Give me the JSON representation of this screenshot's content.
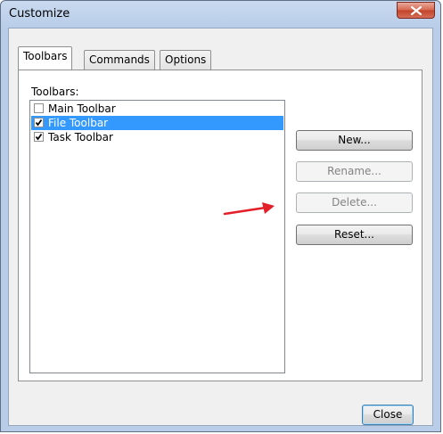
{
  "window": {
    "title": "Customize"
  },
  "tabs": [
    {
      "label": "Toolbars",
      "active": true
    },
    {
      "label": "Commands",
      "active": false
    },
    {
      "label": "Options",
      "active": false
    }
  ],
  "toolbars_group": {
    "label": "Toolbars:",
    "items": [
      {
        "label": "Main Toolbar",
        "checked": false,
        "selected": false
      },
      {
        "label": "File Toolbar",
        "checked": true,
        "selected": true
      },
      {
        "label": "Task Toolbar",
        "checked": true,
        "selected": false
      }
    ]
  },
  "buttons": {
    "new": "New...",
    "rename": "Rename...",
    "delete": "Delete...",
    "reset": "Reset...",
    "close": "Close"
  },
  "colors": {
    "selection": "#3399ff",
    "annotation_arrow": "#e3202a",
    "close_button": "#c7472e"
  },
  "icons": {
    "close": "close-x-icon",
    "checkmark": "checkmark-icon",
    "annotation": "red-arrow-icon"
  }
}
